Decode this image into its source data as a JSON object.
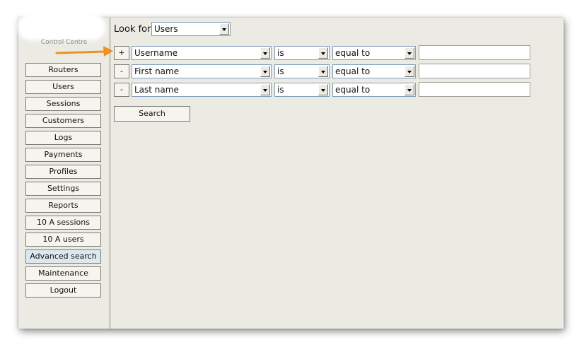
{
  "sidebar": {
    "logo_caption": "Control Centre",
    "items": [
      {
        "label": "Routers"
      },
      {
        "label": "Users"
      },
      {
        "label": "Sessions"
      },
      {
        "label": "Customers"
      },
      {
        "label": "Logs"
      },
      {
        "label": "Payments"
      },
      {
        "label": "Profiles"
      },
      {
        "label": "Settings"
      },
      {
        "label": "Reports"
      },
      {
        "label": "10 A sessions"
      },
      {
        "label": "10 A users"
      },
      {
        "label": "Advanced search",
        "active": true
      },
      {
        "label": "Maintenance"
      },
      {
        "label": "Logout"
      }
    ]
  },
  "search_form": {
    "look_for_label": "Look for",
    "look_for_value": "Users",
    "rows": [
      {
        "toggle": "+",
        "field": "Username",
        "operator": "is",
        "comparison": "equal to",
        "value": ""
      },
      {
        "toggle": "-",
        "field": "First name",
        "operator": "is",
        "comparison": "equal to",
        "value": ""
      },
      {
        "toggle": "-",
        "field": "Last name",
        "operator": "is",
        "comparison": "equal to",
        "value": ""
      }
    ],
    "search_button": "Search"
  },
  "colors": {
    "annotation_arrow": "#f0901e",
    "background": "#ecebe3",
    "active_nav": "#dde8ee"
  }
}
